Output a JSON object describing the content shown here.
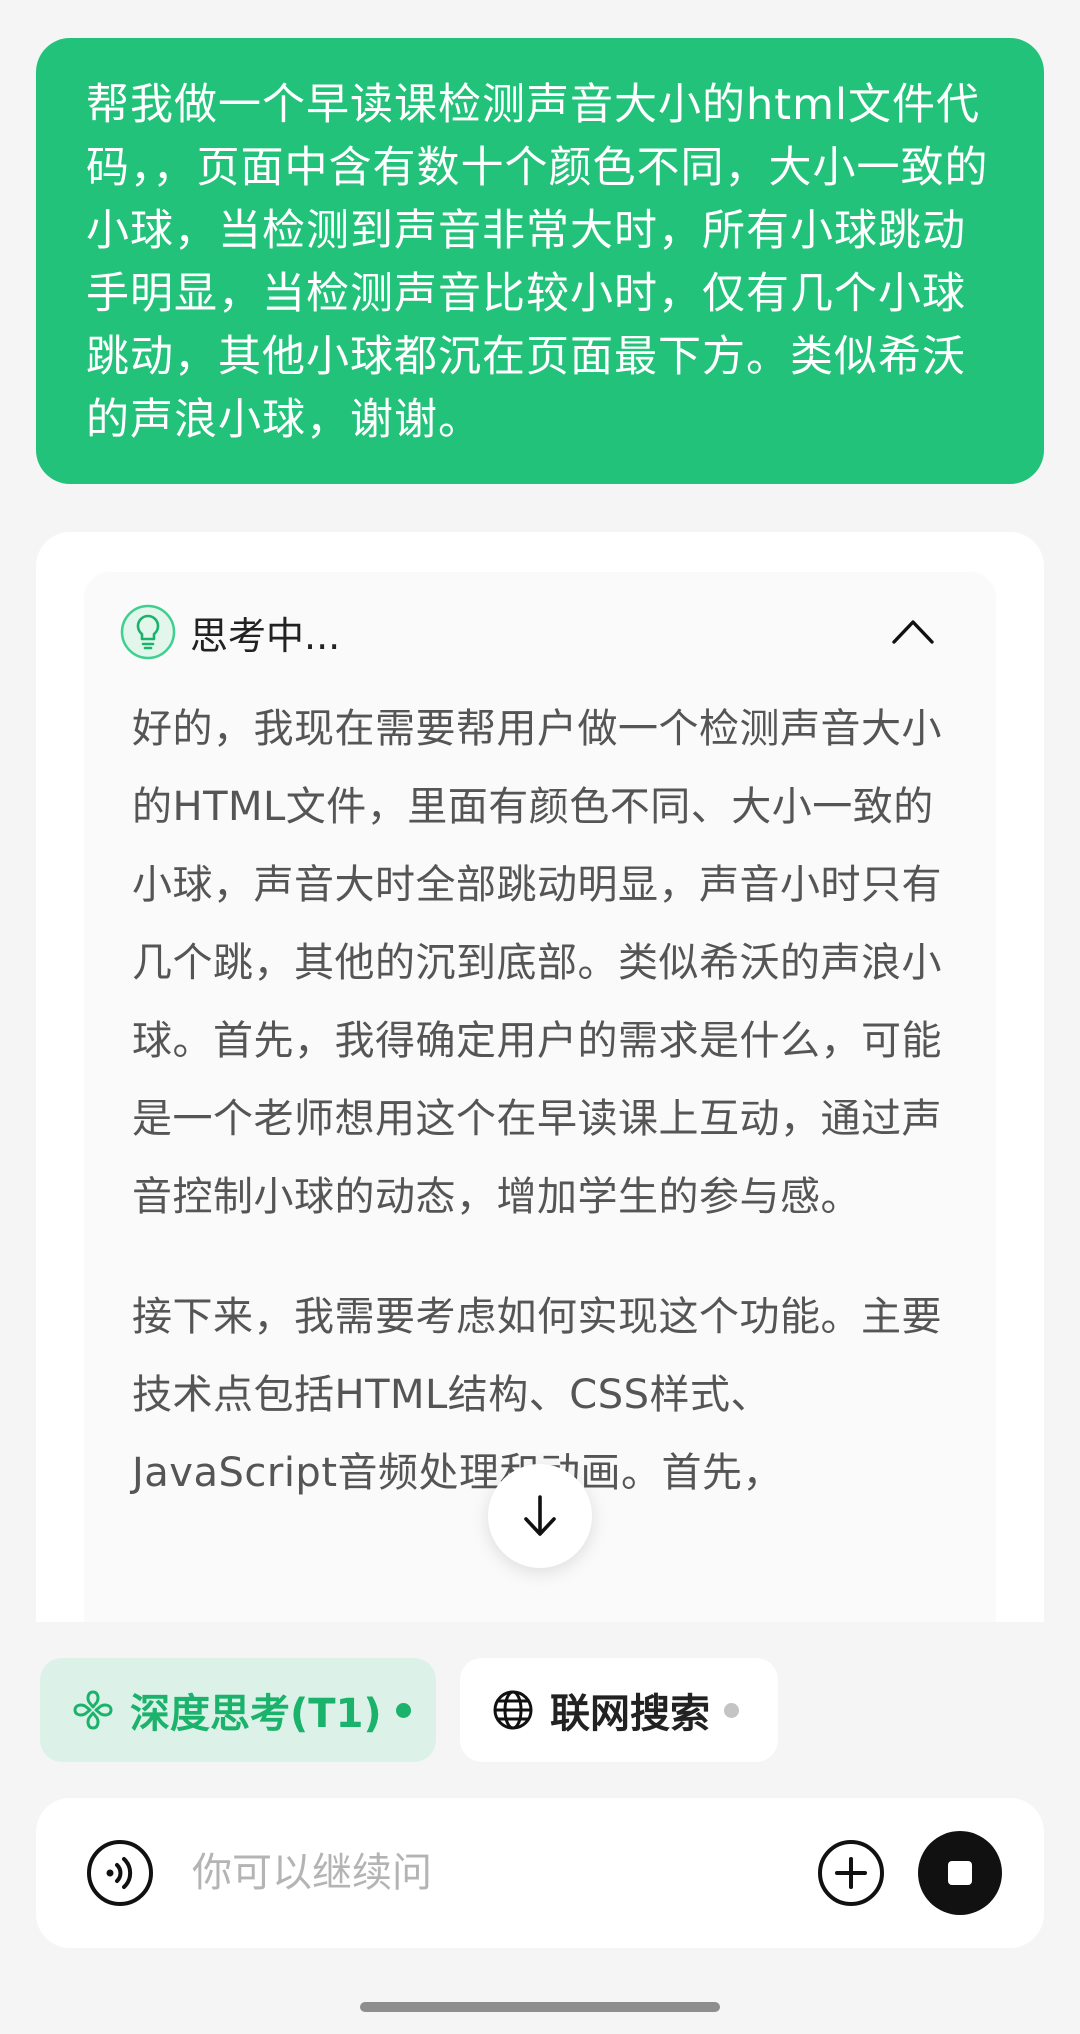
{
  "user_message": {
    "text": "帮我做一个早读课检测声音大小的html文件代码，，页面中含有数十个颜色不同，大小一致的小球，当检测到声音非常大时，所有小球跳动手明显，当检测声音比较小时，仅有几个小球跳动，其他小球都沉在页面最下方。类似希沃的声浪小球，谢谢。"
  },
  "assistant": {
    "thinking": {
      "status": "思考中...",
      "icon": "lightbulb-icon",
      "paragraphs": [
        "好的，我现在需要帮用户做一个检测声音大小的HTML文件，里面有颜色不同、大小一致的小球，声音大时全部跳动明显，声音小时只有几个跳，其他的沉到底部。类似希沃的声浪小球。首先，我得确定用户的需求是什么，可能是一个老师想用这个在早读课上互动，通过声音控制小球的动态，增加学生的参与感。",
        "接下来，我需要考虑如何实现这个功能。主要技术点包括HTML结构、CSS样式、JavaScript音频处理和动画。首先，"
      ]
    }
  },
  "modes": {
    "deep_think": {
      "label": "深度思考(T1)",
      "icon": "deep-think-icon",
      "active": true,
      "dot_color": "#1bb26c"
    },
    "web_search": {
      "label": "联网搜索",
      "icon": "globe-icon",
      "active": false,
      "dot_color": "#c4c4c4"
    }
  },
  "input": {
    "placeholder": "你可以继续问"
  },
  "colors": {
    "accent": "#23c27a",
    "accent_text": "#1bb26c",
    "chip_active_bg": "#dcf2e8"
  }
}
